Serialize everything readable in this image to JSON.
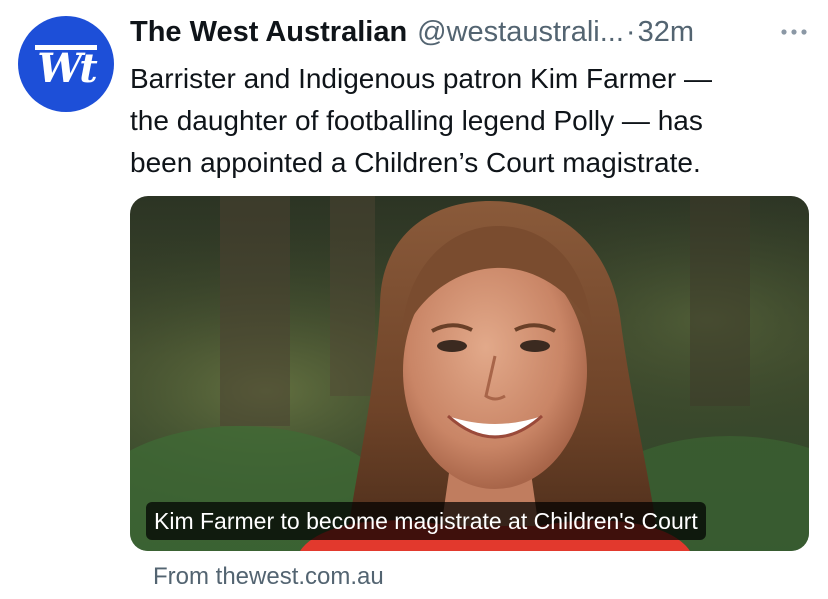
{
  "tweet": {
    "author_name": "The West Australian",
    "author_handle": "@westaustrali...",
    "separator": "·",
    "timestamp": "32m",
    "text_lines": [
      "Barrister and Indigenous patron Kim Farmer —",
      "the daughter of footballing legend Polly — has",
      "been appointed a Children’s Court magistrate."
    ],
    "more_icon": "more-horizontal-icon"
  },
  "avatar": {
    "logo_text": "Wt",
    "background": "#1d4fd8"
  },
  "card": {
    "caption": "Kim Farmer to become magistrate at Children's Court",
    "source": "From thewest.com.au"
  },
  "colors": {
    "text_primary": "#0f1419",
    "text_secondary": "#536471",
    "brand_blue": "#1d4fd8"
  }
}
